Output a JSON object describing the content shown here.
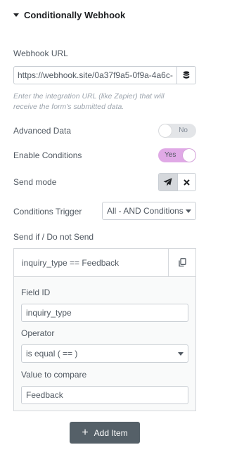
{
  "section": {
    "title": "Conditionally Webhook"
  },
  "webhook": {
    "label": "Webhook URL",
    "value": "https://webhook.site/0a37f9a5-0f9a-4a6c-",
    "help": "Enter the integration URL (like Zapier) that will receive the form's submitted data."
  },
  "advanced_data": {
    "label": "Advanced Data",
    "state": "No",
    "enabled": false
  },
  "enable_conditions": {
    "label": "Enable Conditions",
    "state": "Yes",
    "enabled": true
  },
  "send_mode": {
    "label": "Send mode",
    "options": [
      "send",
      "do-not-send"
    ],
    "selected": "send"
  },
  "conditions_trigger": {
    "label": "Conditions Trigger",
    "value": "All - AND Conditions"
  },
  "send_if": {
    "label": "Send if / Do not Send"
  },
  "repeater_item": {
    "title": "inquiry_type == Feedback",
    "field_id_label": "Field ID",
    "field_id_value": "inquiry_type",
    "operator_label": "Operator",
    "operator_value": "is equal ( == )",
    "compare_label": "Value to compare",
    "compare_value": "Feedback"
  },
  "add_item": {
    "label": "Add Item"
  },
  "colors": {
    "toggle_on": "#e0a9e6",
    "button": "#556068"
  },
  "icons": [
    "caret-down-icon",
    "database-icon",
    "paper-plane-icon",
    "close-icon",
    "copy-icon",
    "plus-icon",
    "chevron-down-icon"
  ]
}
